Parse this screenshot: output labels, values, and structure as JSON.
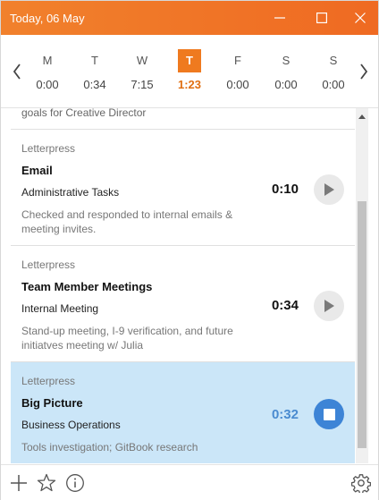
{
  "window": {
    "title": "Today, 06 May",
    "accent_color": "#ef6a22"
  },
  "week": {
    "days": [
      {
        "letter": "M",
        "time": "0:00"
      },
      {
        "letter": "T",
        "time": "0:34"
      },
      {
        "letter": "W",
        "time": "7:15"
      },
      {
        "letter": "T",
        "time": "1:23",
        "active": true
      },
      {
        "letter": "F",
        "time": "0:00"
      },
      {
        "letter": "S",
        "time": "0:00"
      },
      {
        "letter": "S",
        "time": "0:00"
      }
    ]
  },
  "list": {
    "partial_text": "goals for Creative Director",
    "entries": [
      {
        "client": "Letterpress",
        "name": "Email",
        "task": "Administrative Tasks",
        "notes": "Checked and responded to internal emails & meeting invites.",
        "duration": "0:10"
      },
      {
        "client": "Letterpress",
        "name": "Team Member Meetings",
        "task": "Internal Meeting",
        "notes": "Stand-up meeting, I-9 verification, and future initiatves meeting w/ Julia",
        "duration": "0:34"
      },
      {
        "client": "Letterpress",
        "name": "Big Picture",
        "task": "Business Operations",
        "notes": "Tools investigation; GitBook research",
        "duration": "0:32",
        "running": true
      }
    ]
  },
  "scrollbar": {
    "position_fraction": 0.9
  },
  "icons": {
    "minimize": "minimize-icon",
    "maximize": "maximize-icon",
    "close": "close-icon",
    "prev": "chevron-left-icon",
    "next": "chevron-right-icon",
    "play": "play-icon",
    "stop": "stop-icon",
    "add": "plus-icon",
    "favorites": "star-icon",
    "info": "info-icon",
    "settings": "gear-icon"
  }
}
